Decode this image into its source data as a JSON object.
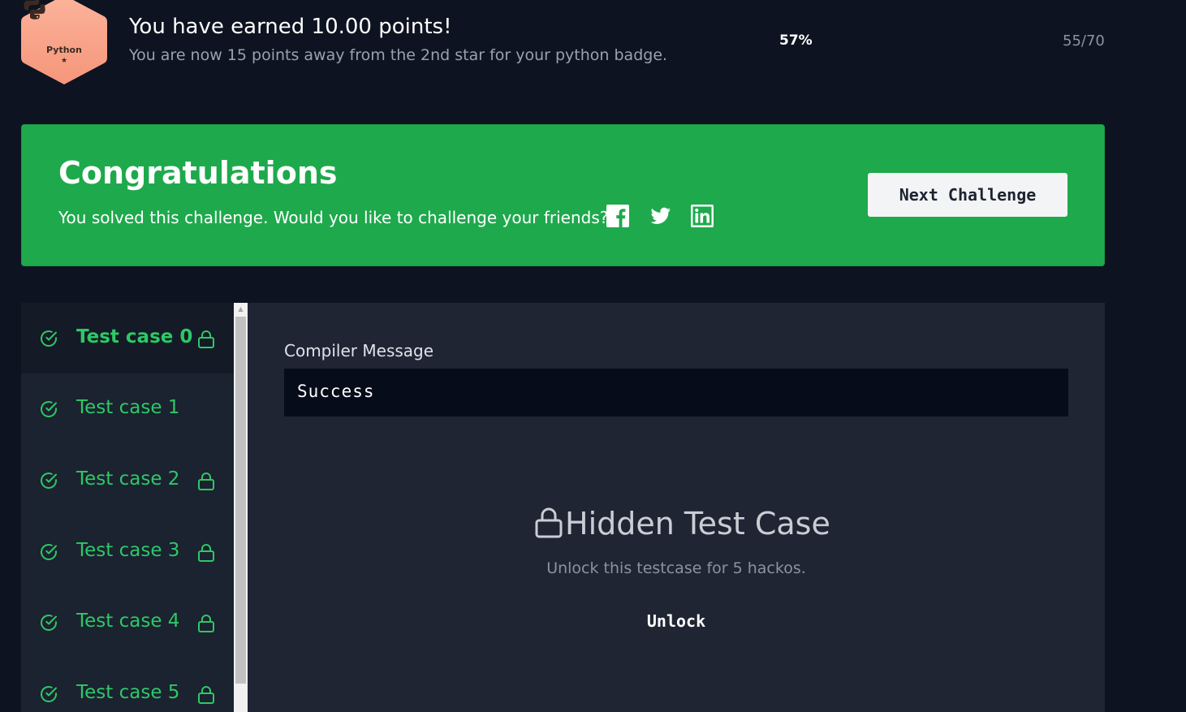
{
  "badge": {
    "label": "Python",
    "star": "★",
    "icon": "python-logo-icon",
    "color": "#f9a488"
  },
  "progress": {
    "title": "You have earned 10.00 points!",
    "subtitle": "You are now 15 points away from the 2nd star for your python badge.",
    "percent": "57%",
    "count": "55/70"
  },
  "congrats": {
    "title": "Congratulations",
    "message": "You solved this challenge. Would you like to challenge your friends?",
    "social_icons": [
      "facebook-icon",
      "twitter-icon",
      "linkedin-icon"
    ],
    "next_button": "Next Challenge",
    "color": "#1ea94c"
  },
  "test_cases": [
    {
      "label": "Test case 0",
      "locked": true,
      "active": true
    },
    {
      "label": "Test case 1",
      "locked": false,
      "active": false
    },
    {
      "label": "Test case 2",
      "locked": true,
      "active": false
    },
    {
      "label": "Test case 3",
      "locked": true,
      "active": false
    },
    {
      "label": "Test case 4",
      "locked": true,
      "active": false
    },
    {
      "label": "Test case 5",
      "locked": true,
      "active": false
    }
  ],
  "detail": {
    "compiler_label": "Compiler Message",
    "compiler_message": "Success",
    "hidden_title": "Hidden Test Case",
    "hidden_subtitle": "Unlock this testcase for 5 hackos.",
    "unlock_button": "Unlock"
  },
  "colors": {
    "background": "#0e1321",
    "success_green": "#2ec866",
    "panel": "#1f2533"
  }
}
